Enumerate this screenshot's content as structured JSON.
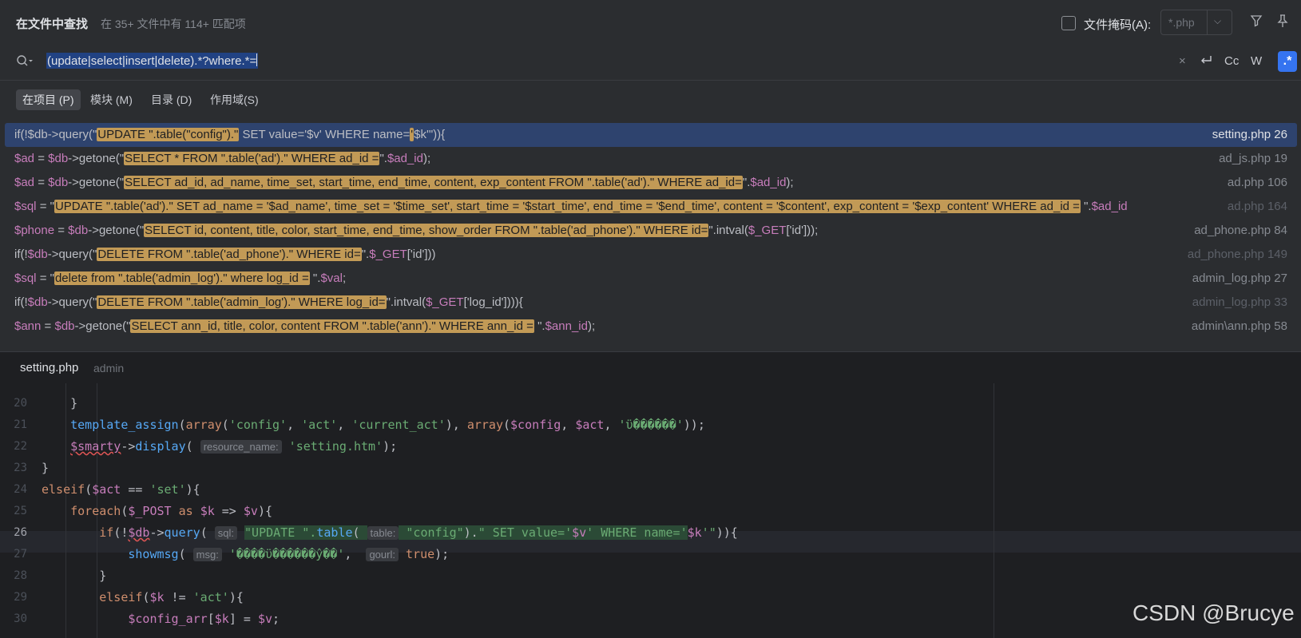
{
  "header": {
    "title": "在文件中查找",
    "count": "在 35+ 文件中有 114+ 匹配项",
    "mask_label": "文件掩码(A):",
    "mask_value": "*.php"
  },
  "search": {
    "query": "(update|select|insert|delete).*?where.*=",
    "opt_cc": "Cc",
    "opt_w": "W",
    "opt_regex": ".*"
  },
  "scopes": [
    "在项目 (P)",
    "模块 (M)",
    "目录 (D)",
    "作用域(S)"
  ],
  "results": [
    {
      "file": "setting.php 26"
    },
    {
      "file": "ad_js.php 19"
    },
    {
      "file": "ad.php 106"
    },
    {
      "file": "ad.php 164"
    },
    {
      "file": "ad_phone.php 84"
    },
    {
      "file": "ad_phone.php 149"
    },
    {
      "file": "admin_log.php 27"
    },
    {
      "file": "admin_log.php 33"
    },
    {
      "file": "admin\\ann.php 58"
    }
  ],
  "editor": {
    "file_name": "setting.php",
    "file_dir": "admin",
    "line_numbers": [
      "20",
      "21",
      "22",
      "23",
      "24",
      "25",
      "26",
      "27",
      "28",
      "29",
      "30"
    ],
    "hints": {
      "resource_name": "resource_name:",
      "sql": "sql:",
      "table": "table:",
      "msg": "msg:",
      "gourl": "gourl:"
    }
  },
  "watermark": "CSDN @Brucye"
}
